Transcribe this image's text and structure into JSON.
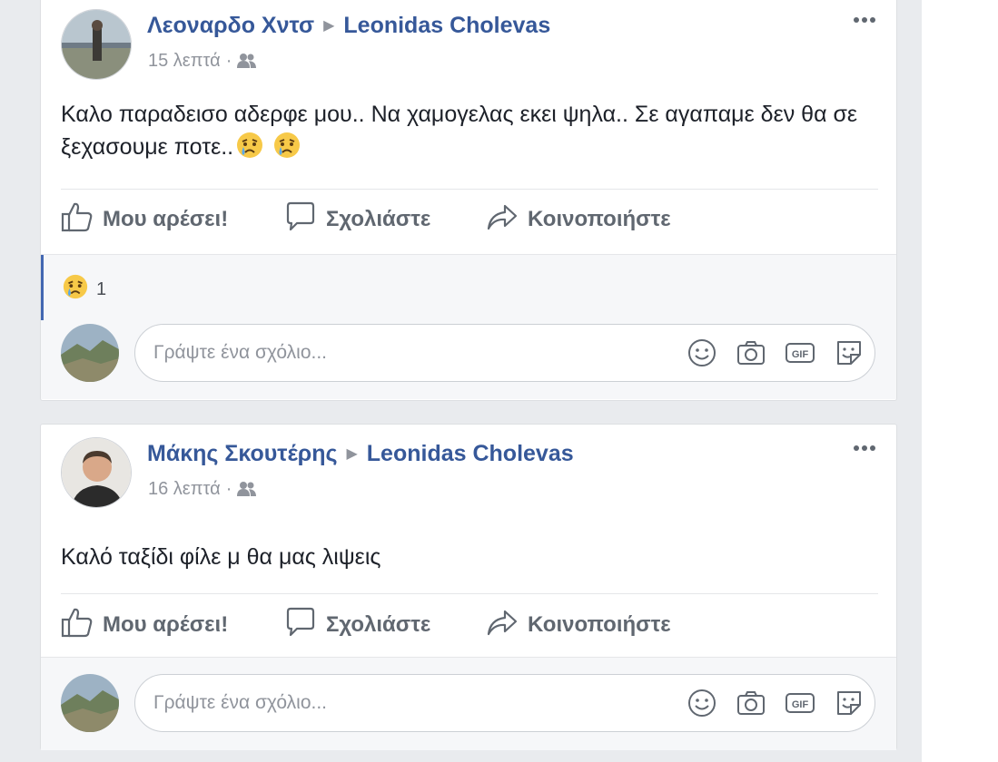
{
  "posts": [
    {
      "author": "Λεοναρδο Χντσ",
      "target": "Leonidas Cholevas",
      "time": "15 λεπτά",
      "separator": "·",
      "text": "Καλο παραδεισο αδερφε μου.. Να χαμογελας εκει ψηλα.. Σε αγαπαμε δεν θα σε ξεχασουμε ποτε..",
      "emojis": [
        "crying-face-emoji",
        "crying-face-emoji"
      ],
      "actions": {
        "like": "Μου αρέσει!",
        "comment": "Σχολιάστε",
        "share": "Κοινοποιήστε"
      },
      "reactions": {
        "icon": "sad-reaction-icon",
        "count": "1"
      },
      "comment_placeholder": "Γράψτε ένα σχόλιο..."
    },
    {
      "author": "Μάκης Σκουτέρης",
      "target": "Leonidas Cholevas",
      "time": "16 λεπτά",
      "separator": "·",
      "text": "Καλό ταξίδι φίλε μ θα μας λιψεις",
      "actions": {
        "like": "Μου αρέσει!",
        "comment": "Σχολιάστε",
        "share": "Κοινοποιήστε"
      },
      "comment_placeholder": "Γράψτε ένα σχόλιο..."
    }
  ],
  "colors": {
    "link": "#365899",
    "meta": "#90949c",
    "action": "#606770",
    "accent": "#4267b2",
    "background": "#e9ebee"
  }
}
